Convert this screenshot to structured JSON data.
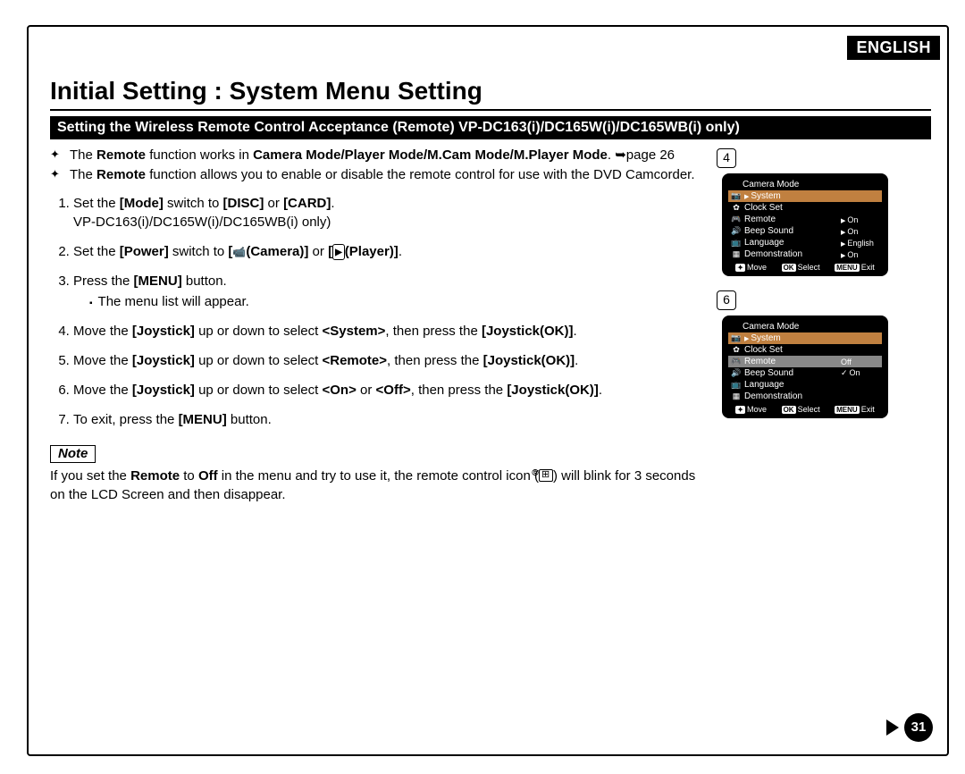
{
  "lang_tag": "ENGLISH",
  "title": "Initial Setting : System Menu Setting",
  "band": "Setting the Wireless Remote Control Acceptance (Remote) VP-DC163(i)/DC165W(i)/DC165WB(i) only)",
  "bullets": {
    "b1_pre": "The ",
    "b1_bold1": "Remote",
    "b1_mid": " function works in ",
    "b1_bold2": "Camera Mode/Player Mode/M.Cam Mode/M.Player Mode",
    "b1_post": ". ",
    "b1_pageref": "page 26",
    "b2_pre": "The ",
    "b2_bold": "Remote",
    "b2_post": " function allows you to enable or disable the remote control for use with the DVD Camcorder."
  },
  "steps": {
    "s1_a": "Set the ",
    "s1_b": "[Mode]",
    "s1_c": " switch to ",
    "s1_d": "[DISC]",
    "s1_e": " or ",
    "s1_f": "[CARD]",
    "s1_g": ".",
    "s1_sub": "VP-DC163(i)/DC165W(i)/DC165WB(i) only)",
    "s2_a": "Set the ",
    "s2_b": "[Power]",
    "s2_c": " switch to ",
    "s2_d": "(Camera)]",
    "s2_e": " or ",
    "s2_f": "(Player)]",
    "s2_g": ".",
    "s3_a": "Press the ",
    "s3_b": "[MENU]",
    "s3_c": " button.",
    "s3_sub": "The menu list will appear.",
    "s4_a": "Move the ",
    "s4_b": "[Joystick]",
    "s4_c": " up or down to select ",
    "s4_d": "<System>",
    "s4_e": ", then press the ",
    "s4_f": "[Joystick(OK)]",
    "s4_g": ".",
    "s5_a": "Move the ",
    "s5_b": "[Joystick]",
    "s5_c": " up or down to select ",
    "s5_d": "<Remote>",
    "s5_e": ", then press the ",
    "s5_f": "[Joystick(OK)]",
    "s5_g": ".",
    "s6_a": "Move the ",
    "s6_b": "[Joystick]",
    "s6_c": " up or down to select ",
    "s6_d": "<On>",
    "s6_e": " or ",
    "s6_f": "<Off>",
    "s6_g": ", then press the ",
    "s6_h": "[Joystick(OK)]",
    "s6_i": ".",
    "s7_a": "To exit, press the ",
    "s7_b": "[MENU]",
    "s7_c": " button."
  },
  "note_label": "Note",
  "note": {
    "a": "If you set the ",
    "b": "Remote",
    "c": " to ",
    "d": "Off",
    "e": " in the menu and try to use it, the remote control icon (",
    "f": ") will blink for 3 seconds on the LCD Screen and then disappear."
  },
  "fig4": {
    "callout": "4",
    "title": "Camera Mode",
    "items": [
      {
        "ico": "📷",
        "lbl": "System",
        "val": "",
        "hl": "hl-orange",
        "tri": true
      },
      {
        "ico": "✿",
        "lbl": "Clock Set",
        "val": ""
      },
      {
        "ico": "🎮",
        "lbl": "Remote",
        "val": "On",
        "tri": true
      },
      {
        "ico": "🔊",
        "lbl": "Beep Sound",
        "val": "On",
        "tri": true
      },
      {
        "ico": "📺",
        "lbl": "Language",
        "val": "English",
        "tri": true
      },
      {
        "ico": "▦",
        "lbl": "Demonstration",
        "val": "On",
        "tri": true
      }
    ],
    "footer": {
      "move": "Move",
      "select": "Select",
      "exit": "Exit"
    }
  },
  "fig6": {
    "callout": "6",
    "title": "Camera Mode",
    "items": [
      {
        "ico": "📷",
        "lbl": "System",
        "val": "",
        "hl": "hl-orange",
        "tri": true
      },
      {
        "ico": "✿",
        "lbl": "Clock Set",
        "val": ""
      },
      {
        "ico": "🎮",
        "lbl": "Remote",
        "val": "Off",
        "hl": "hl-grey"
      },
      {
        "ico": "🔊",
        "lbl": "Beep Sound",
        "val": "On",
        "chk": true
      },
      {
        "ico": "📺",
        "lbl": "Language",
        "val": ""
      },
      {
        "ico": "▦",
        "lbl": "Demonstration",
        "val": ""
      }
    ],
    "footer": {
      "move": "Move",
      "select": "Select",
      "exit": "Exit"
    }
  },
  "page_number": "31"
}
